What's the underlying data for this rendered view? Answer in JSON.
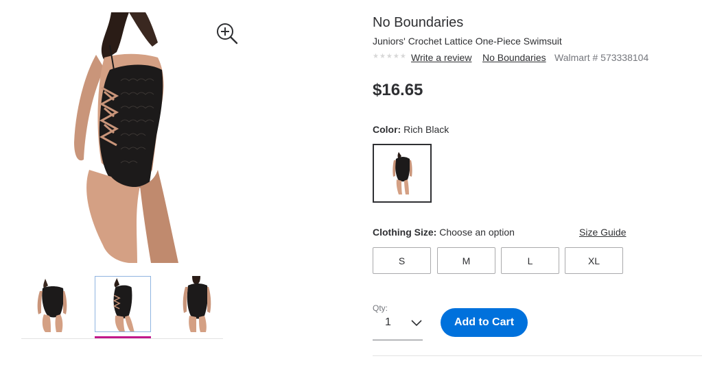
{
  "product": {
    "brand": "No Boundaries",
    "title": "Juniors' Crochet Lattice One-Piece Swimsuit",
    "rating_stars": "★★★★★",
    "review_link": "Write a review",
    "brand_link": "No Boundaries",
    "item_number": "Walmart # 573338104",
    "price": "$16.65"
  },
  "gallery": {
    "zoom_icon": "zoom-in-icon",
    "thumbnails": [
      {
        "icon": "front-view-thumbnail",
        "selected": false
      },
      {
        "icon": "side-view-thumbnail",
        "selected": true
      },
      {
        "icon": "back-view-thumbnail",
        "selected": false
      }
    ]
  },
  "color": {
    "label": "Color:",
    "value": "Rich Black"
  },
  "size": {
    "label": "Clothing Size:",
    "value": "Choose an option",
    "guide_link": "Size Guide",
    "options": [
      "S",
      "M",
      "L",
      "XL"
    ]
  },
  "quantity": {
    "label": "Qty:",
    "value": "1"
  },
  "cart": {
    "button_label": "Add to Cart",
    "accent": "#0071dc"
  },
  "colors": {
    "selected_indicator": "#c2188a",
    "text": "#2e2f32"
  }
}
